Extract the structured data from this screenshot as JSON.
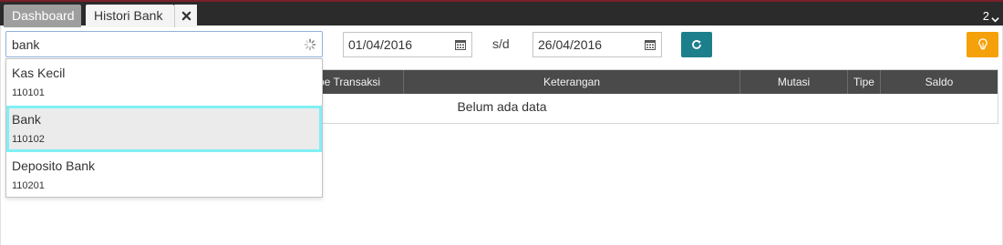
{
  "tabs": {
    "dashboard_label": "Dashboard",
    "histori_label": "Histori Bank",
    "open_count": "2"
  },
  "filter": {
    "search_value": "bank",
    "date_from": "01/04/2016",
    "separator": "s/d",
    "date_to": "26/04/2016"
  },
  "autocomplete": {
    "options": [
      {
        "name": "Kas Kecil",
        "code": "110101"
      },
      {
        "name": "Bank",
        "code": "110102"
      },
      {
        "name": "Deposito Bank",
        "code": "110201"
      }
    ]
  },
  "table": {
    "columns": [
      "pe Transaksi",
      "Keterangan",
      "Mutasi",
      "Tipe",
      "Saldo"
    ],
    "empty_message": "Belum ada data"
  },
  "colors": {
    "topbar": "#2b2b2b",
    "refresh_button": "#1e7f8c",
    "bulb_button": "#f5a10a",
    "highlight_border": "#7ff0f5",
    "table_header": "#4a4a4a"
  },
  "icons": {
    "tab_close": "close-icon",
    "counter": "chevron-down-icon",
    "search_spinner": "spinner-icon",
    "date_picker": "calendar-icon",
    "refresh": "refresh-icon",
    "bulb": "lightbulb-icon"
  }
}
